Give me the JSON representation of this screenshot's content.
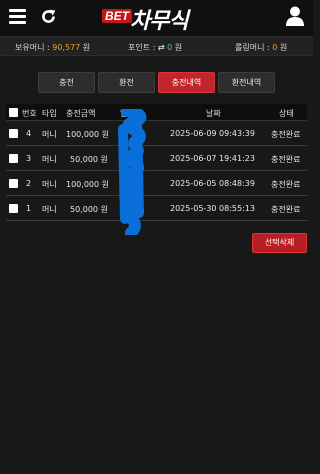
{
  "header": {
    "logo_badge": "BET",
    "logo_text": "차무식",
    "icons": [
      "menu-icon",
      "refresh-icon",
      "user-icon"
    ]
  },
  "balance_bar": {
    "money_label": "보유머니 :",
    "money_value": "90,577",
    "money_unit": "원",
    "point_label": "포인트 :",
    "point_value": "0",
    "point_unit": "원",
    "rolling_label": "롤링머니 :",
    "rolling_value": "0",
    "rolling_unit": "원",
    "money_color": "#f0a02a",
    "point_color": "#4cd35a"
  },
  "tabs": [
    {
      "label": "충전"
    },
    {
      "label": "환전"
    },
    {
      "label": "충전내역",
      "active": true
    },
    {
      "label": "환전내역"
    }
  ],
  "table": {
    "columns": [
      "번호",
      "타입",
      "충전금액",
      "입금자",
      "날짜",
      "상태"
    ],
    "rows": [
      {
        "no": "4",
        "type": "머니",
        "amount": "100,000 원",
        "depositor": "",
        "date": "2025-06-09 09:43:39",
        "status": "충전완료"
      },
      {
        "no": "3",
        "type": "머니",
        "amount": "50,000 원",
        "depositor": "",
        "date": "2025-06-07 19:41:23",
        "status": "충전완료"
      },
      {
        "no": "2",
        "type": "머니",
        "amount": "100,000 원",
        "depositor": "",
        "date": "2025-06-05 08:48:39",
        "status": "충전완료"
      },
      {
        "no": "1",
        "type": "머니",
        "amount": "50,000 원",
        "depositor": "",
        "date": "2025-05-30 08:55:13",
        "status": "충전완료"
      }
    ]
  },
  "actions": {
    "delete_selected": "선택삭제"
  },
  "colors": {
    "accent_red": "#c0262c",
    "background": "#181818"
  }
}
